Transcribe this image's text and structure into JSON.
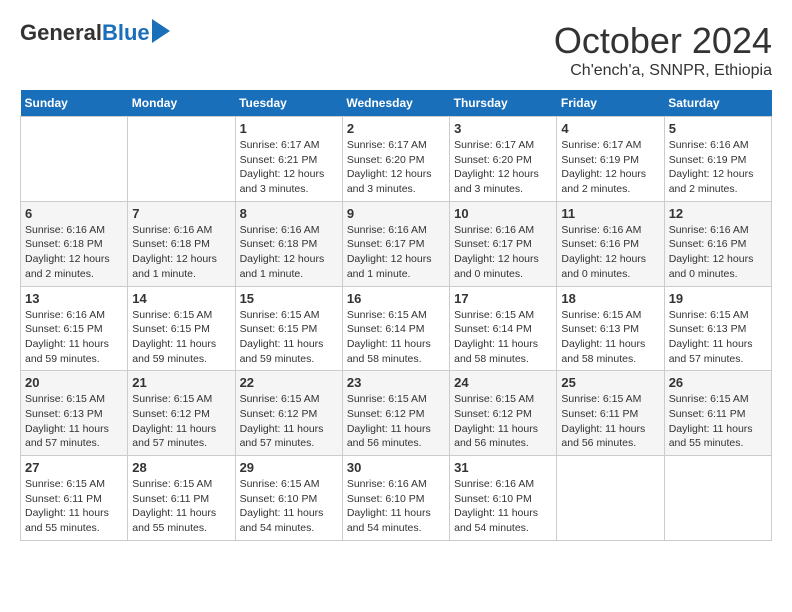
{
  "logo": {
    "general": "General",
    "blue": "Blue"
  },
  "title": "October 2024",
  "subtitle": "Ch'ench'a, SNNPR, Ethiopia",
  "days_header": [
    "Sunday",
    "Monday",
    "Tuesday",
    "Wednesday",
    "Thursday",
    "Friday",
    "Saturday"
  ],
  "weeks": [
    [
      {
        "day": "",
        "info": ""
      },
      {
        "day": "",
        "info": ""
      },
      {
        "day": "1",
        "info": "Sunrise: 6:17 AM\nSunset: 6:21 PM\nDaylight: 12 hours and 3 minutes."
      },
      {
        "day": "2",
        "info": "Sunrise: 6:17 AM\nSunset: 6:20 PM\nDaylight: 12 hours and 3 minutes."
      },
      {
        "day": "3",
        "info": "Sunrise: 6:17 AM\nSunset: 6:20 PM\nDaylight: 12 hours and 3 minutes."
      },
      {
        "day": "4",
        "info": "Sunrise: 6:17 AM\nSunset: 6:19 PM\nDaylight: 12 hours and 2 minutes."
      },
      {
        "day": "5",
        "info": "Sunrise: 6:16 AM\nSunset: 6:19 PM\nDaylight: 12 hours and 2 minutes."
      }
    ],
    [
      {
        "day": "6",
        "info": "Sunrise: 6:16 AM\nSunset: 6:18 PM\nDaylight: 12 hours and 2 minutes."
      },
      {
        "day": "7",
        "info": "Sunrise: 6:16 AM\nSunset: 6:18 PM\nDaylight: 12 hours and 1 minute."
      },
      {
        "day": "8",
        "info": "Sunrise: 6:16 AM\nSunset: 6:18 PM\nDaylight: 12 hours and 1 minute."
      },
      {
        "day": "9",
        "info": "Sunrise: 6:16 AM\nSunset: 6:17 PM\nDaylight: 12 hours and 1 minute."
      },
      {
        "day": "10",
        "info": "Sunrise: 6:16 AM\nSunset: 6:17 PM\nDaylight: 12 hours and 0 minutes."
      },
      {
        "day": "11",
        "info": "Sunrise: 6:16 AM\nSunset: 6:16 PM\nDaylight: 12 hours and 0 minutes."
      },
      {
        "day": "12",
        "info": "Sunrise: 6:16 AM\nSunset: 6:16 PM\nDaylight: 12 hours and 0 minutes."
      }
    ],
    [
      {
        "day": "13",
        "info": "Sunrise: 6:16 AM\nSunset: 6:15 PM\nDaylight: 11 hours and 59 minutes."
      },
      {
        "day": "14",
        "info": "Sunrise: 6:15 AM\nSunset: 6:15 PM\nDaylight: 11 hours and 59 minutes."
      },
      {
        "day": "15",
        "info": "Sunrise: 6:15 AM\nSunset: 6:15 PM\nDaylight: 11 hours and 59 minutes."
      },
      {
        "day": "16",
        "info": "Sunrise: 6:15 AM\nSunset: 6:14 PM\nDaylight: 11 hours and 58 minutes."
      },
      {
        "day": "17",
        "info": "Sunrise: 6:15 AM\nSunset: 6:14 PM\nDaylight: 11 hours and 58 minutes."
      },
      {
        "day": "18",
        "info": "Sunrise: 6:15 AM\nSunset: 6:13 PM\nDaylight: 11 hours and 58 minutes."
      },
      {
        "day": "19",
        "info": "Sunrise: 6:15 AM\nSunset: 6:13 PM\nDaylight: 11 hours and 57 minutes."
      }
    ],
    [
      {
        "day": "20",
        "info": "Sunrise: 6:15 AM\nSunset: 6:13 PM\nDaylight: 11 hours and 57 minutes."
      },
      {
        "day": "21",
        "info": "Sunrise: 6:15 AM\nSunset: 6:12 PM\nDaylight: 11 hours and 57 minutes."
      },
      {
        "day": "22",
        "info": "Sunrise: 6:15 AM\nSunset: 6:12 PM\nDaylight: 11 hours and 57 minutes."
      },
      {
        "day": "23",
        "info": "Sunrise: 6:15 AM\nSunset: 6:12 PM\nDaylight: 11 hours and 56 minutes."
      },
      {
        "day": "24",
        "info": "Sunrise: 6:15 AM\nSunset: 6:12 PM\nDaylight: 11 hours and 56 minutes."
      },
      {
        "day": "25",
        "info": "Sunrise: 6:15 AM\nSunset: 6:11 PM\nDaylight: 11 hours and 56 minutes."
      },
      {
        "day": "26",
        "info": "Sunrise: 6:15 AM\nSunset: 6:11 PM\nDaylight: 11 hours and 55 minutes."
      }
    ],
    [
      {
        "day": "27",
        "info": "Sunrise: 6:15 AM\nSunset: 6:11 PM\nDaylight: 11 hours and 55 minutes."
      },
      {
        "day": "28",
        "info": "Sunrise: 6:15 AM\nSunset: 6:11 PM\nDaylight: 11 hours and 55 minutes."
      },
      {
        "day": "29",
        "info": "Sunrise: 6:15 AM\nSunset: 6:10 PM\nDaylight: 11 hours and 54 minutes."
      },
      {
        "day": "30",
        "info": "Sunrise: 6:16 AM\nSunset: 6:10 PM\nDaylight: 11 hours and 54 minutes."
      },
      {
        "day": "31",
        "info": "Sunrise: 6:16 AM\nSunset: 6:10 PM\nDaylight: 11 hours and 54 minutes."
      },
      {
        "day": "",
        "info": ""
      },
      {
        "day": "",
        "info": ""
      }
    ]
  ]
}
